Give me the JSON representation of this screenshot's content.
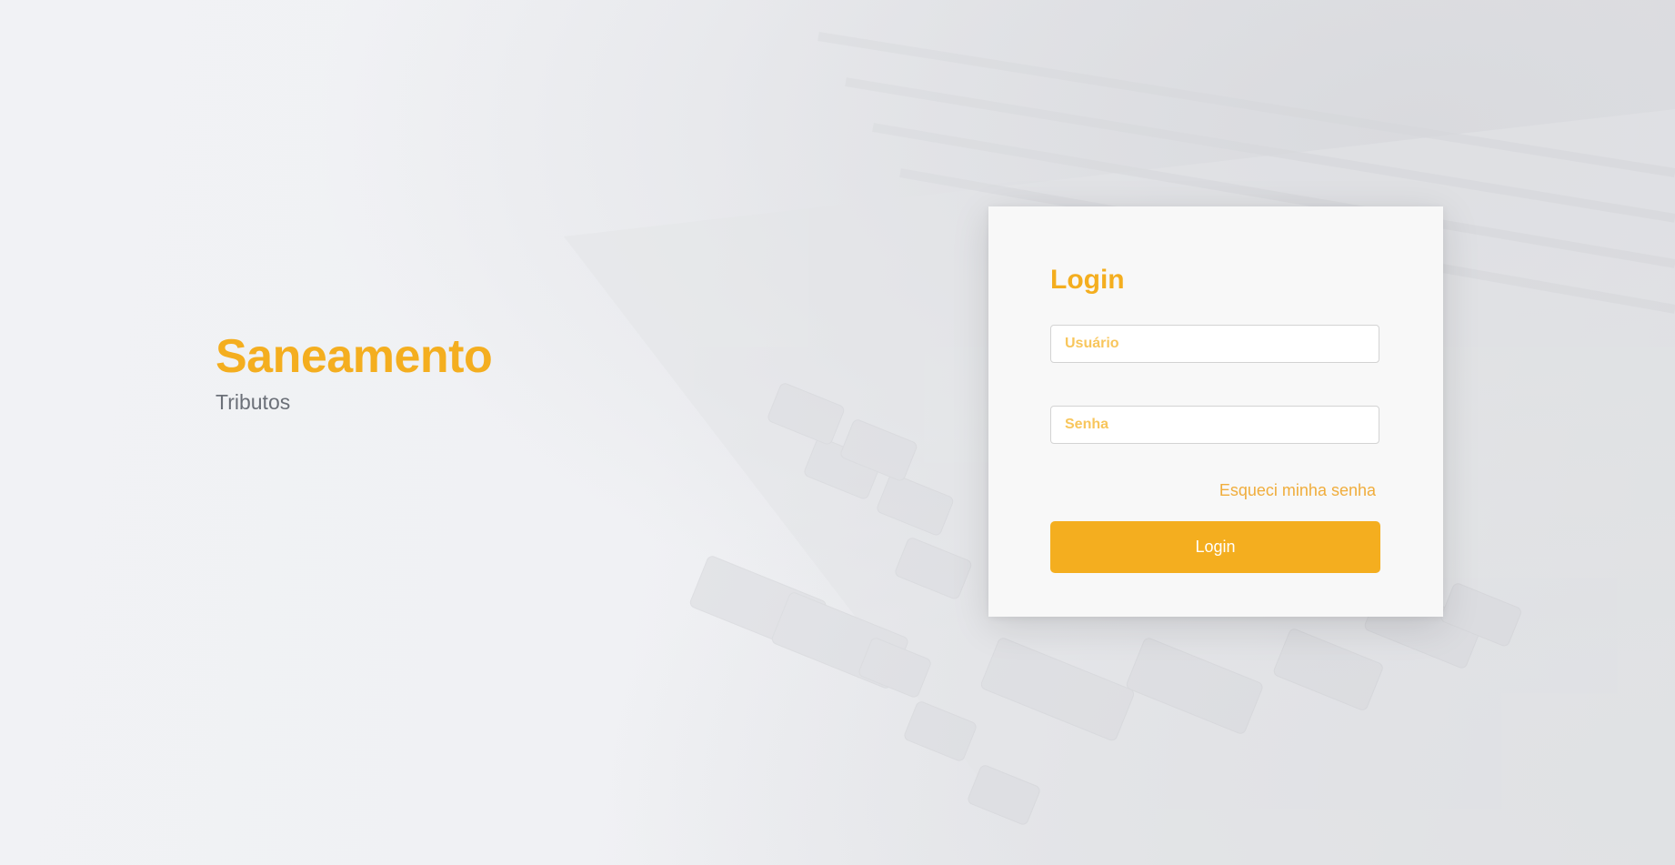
{
  "brand": {
    "title": "Saneamento",
    "subtitle": "Tributos"
  },
  "login": {
    "title": "Login",
    "username_placeholder": "Usuário",
    "username_value": "",
    "password_placeholder": "Senha",
    "password_value": "",
    "forgot_label": "Esqueci minha senha",
    "submit_label": "Login"
  },
  "colors": {
    "accent": "#f4ae1f",
    "placeholder": "#f8c65c",
    "subtitle": "#6b7078",
    "card_background": "#f8f8f8",
    "page_background": "#f0f1f4"
  },
  "background": {
    "image": "laptop-keyboard-photo"
  }
}
